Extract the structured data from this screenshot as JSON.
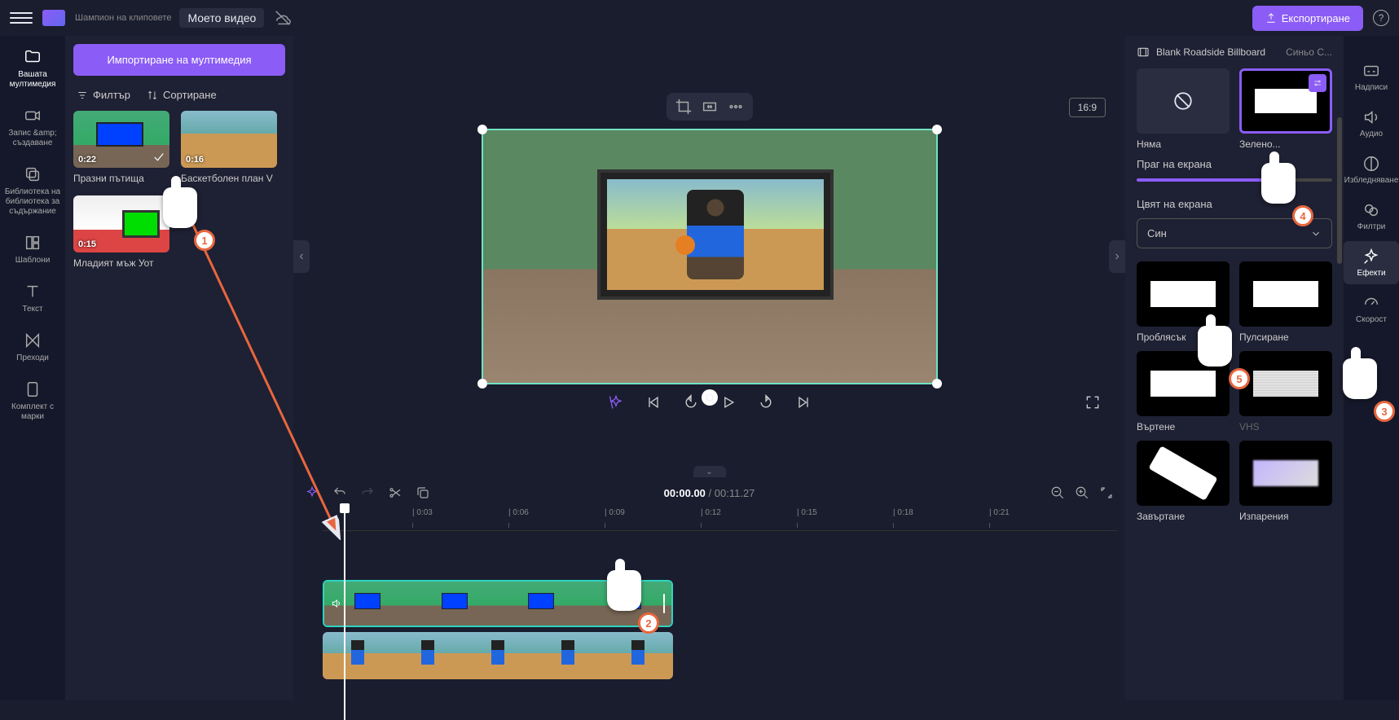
{
  "header": {
    "breadcrumb": "Шампион на клиповете",
    "video_title": "Моето видео",
    "export_label": "Експортиране"
  },
  "left_nav": [
    {
      "label": "Вашата мултимедия"
    },
    {
      "label": "Запис &amp;\nсъздаване"
    },
    {
      "label": "Библиотека на библиотека за съдържание"
    },
    {
      "label": "Шаблони"
    },
    {
      "label": "Текст"
    },
    {
      "label": "Преходи"
    },
    {
      "label": "Комплект с марки"
    }
  ],
  "media_panel": {
    "import_label": "Импортиране на мултимедия",
    "filter_label": "Филтър",
    "sort_label": "Сортиране",
    "items": [
      {
        "duration": "0:22",
        "name": "Празни пътища"
      },
      {
        "duration": "0:16",
        "name": "Баскетболен план V"
      },
      {
        "duration": "0:15",
        "name": "Младият мъж Уот"
      }
    ]
  },
  "preview": {
    "aspect": "16:9"
  },
  "timeline": {
    "current": "00:00.00",
    "duration": "00:11.27",
    "marks": [
      "0:03",
      "0:06",
      "0:09",
      "0:12",
      "0:15",
      "0:18",
      "0:21"
    ]
  },
  "right_panel": {
    "clip_name": "Blank Roadside Billboard",
    "secondary": "Синьо С...",
    "none_label": "Няма",
    "green_label": "Зелено...",
    "threshold_label": "Праг на екрана",
    "color_label": "Цвят на екрана",
    "color_value": "Син",
    "effects": [
      {
        "label": "Проблясък"
      },
      {
        "label": "Пулсиране"
      },
      {
        "label": "Въртене"
      },
      {
        "label": "VHS"
      },
      {
        "label": "Завъртане"
      },
      {
        "label": "Изпарения"
      }
    ]
  },
  "right_nav": [
    {
      "label": "Надписи"
    },
    {
      "label": "Аудио"
    },
    {
      "label": "Избледняване"
    },
    {
      "label": "Филтри"
    },
    {
      "label": "Ефекти"
    },
    {
      "label": "Скорост"
    }
  ],
  "markers": {
    "m1": "1",
    "m2": "2",
    "m3": "3",
    "m4": "4",
    "m5": "5"
  }
}
